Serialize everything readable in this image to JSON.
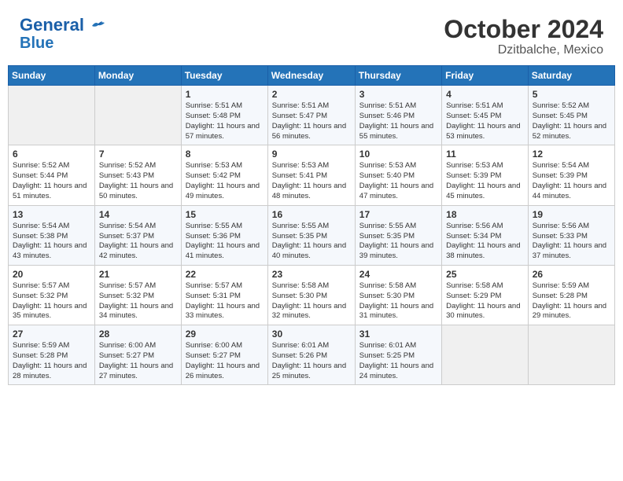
{
  "header": {
    "logo_line1": "General",
    "logo_line2": "Blue",
    "month": "October 2024",
    "location": "Dzitbalche, Mexico"
  },
  "weekdays": [
    "Sunday",
    "Monday",
    "Tuesday",
    "Wednesday",
    "Thursday",
    "Friday",
    "Saturday"
  ],
  "weeks": [
    [
      {
        "day": "",
        "sunrise": "",
        "sunset": "",
        "daylight": ""
      },
      {
        "day": "",
        "sunrise": "",
        "sunset": "",
        "daylight": ""
      },
      {
        "day": "1",
        "sunrise": "Sunrise: 5:51 AM",
        "sunset": "Sunset: 5:48 PM",
        "daylight": "Daylight: 11 hours and 57 minutes."
      },
      {
        "day": "2",
        "sunrise": "Sunrise: 5:51 AM",
        "sunset": "Sunset: 5:47 PM",
        "daylight": "Daylight: 11 hours and 56 minutes."
      },
      {
        "day": "3",
        "sunrise": "Sunrise: 5:51 AM",
        "sunset": "Sunset: 5:46 PM",
        "daylight": "Daylight: 11 hours and 55 minutes."
      },
      {
        "day": "4",
        "sunrise": "Sunrise: 5:51 AM",
        "sunset": "Sunset: 5:45 PM",
        "daylight": "Daylight: 11 hours and 53 minutes."
      },
      {
        "day": "5",
        "sunrise": "Sunrise: 5:52 AM",
        "sunset": "Sunset: 5:45 PM",
        "daylight": "Daylight: 11 hours and 52 minutes."
      }
    ],
    [
      {
        "day": "6",
        "sunrise": "Sunrise: 5:52 AM",
        "sunset": "Sunset: 5:44 PM",
        "daylight": "Daylight: 11 hours and 51 minutes."
      },
      {
        "day": "7",
        "sunrise": "Sunrise: 5:52 AM",
        "sunset": "Sunset: 5:43 PM",
        "daylight": "Daylight: 11 hours and 50 minutes."
      },
      {
        "day": "8",
        "sunrise": "Sunrise: 5:53 AM",
        "sunset": "Sunset: 5:42 PM",
        "daylight": "Daylight: 11 hours and 49 minutes."
      },
      {
        "day": "9",
        "sunrise": "Sunrise: 5:53 AM",
        "sunset": "Sunset: 5:41 PM",
        "daylight": "Daylight: 11 hours and 48 minutes."
      },
      {
        "day": "10",
        "sunrise": "Sunrise: 5:53 AM",
        "sunset": "Sunset: 5:40 PM",
        "daylight": "Daylight: 11 hours and 47 minutes."
      },
      {
        "day": "11",
        "sunrise": "Sunrise: 5:53 AM",
        "sunset": "Sunset: 5:39 PM",
        "daylight": "Daylight: 11 hours and 45 minutes."
      },
      {
        "day": "12",
        "sunrise": "Sunrise: 5:54 AM",
        "sunset": "Sunset: 5:39 PM",
        "daylight": "Daylight: 11 hours and 44 minutes."
      }
    ],
    [
      {
        "day": "13",
        "sunrise": "Sunrise: 5:54 AM",
        "sunset": "Sunset: 5:38 PM",
        "daylight": "Daylight: 11 hours and 43 minutes."
      },
      {
        "day": "14",
        "sunrise": "Sunrise: 5:54 AM",
        "sunset": "Sunset: 5:37 PM",
        "daylight": "Daylight: 11 hours and 42 minutes."
      },
      {
        "day": "15",
        "sunrise": "Sunrise: 5:55 AM",
        "sunset": "Sunset: 5:36 PM",
        "daylight": "Daylight: 11 hours and 41 minutes."
      },
      {
        "day": "16",
        "sunrise": "Sunrise: 5:55 AM",
        "sunset": "Sunset: 5:35 PM",
        "daylight": "Daylight: 11 hours and 40 minutes."
      },
      {
        "day": "17",
        "sunrise": "Sunrise: 5:55 AM",
        "sunset": "Sunset: 5:35 PM",
        "daylight": "Daylight: 11 hours and 39 minutes."
      },
      {
        "day": "18",
        "sunrise": "Sunrise: 5:56 AM",
        "sunset": "Sunset: 5:34 PM",
        "daylight": "Daylight: 11 hours and 38 minutes."
      },
      {
        "day": "19",
        "sunrise": "Sunrise: 5:56 AM",
        "sunset": "Sunset: 5:33 PM",
        "daylight": "Daylight: 11 hours and 37 minutes."
      }
    ],
    [
      {
        "day": "20",
        "sunrise": "Sunrise: 5:57 AM",
        "sunset": "Sunset: 5:32 PM",
        "daylight": "Daylight: 11 hours and 35 minutes."
      },
      {
        "day": "21",
        "sunrise": "Sunrise: 5:57 AM",
        "sunset": "Sunset: 5:32 PM",
        "daylight": "Daylight: 11 hours and 34 minutes."
      },
      {
        "day": "22",
        "sunrise": "Sunrise: 5:57 AM",
        "sunset": "Sunset: 5:31 PM",
        "daylight": "Daylight: 11 hours and 33 minutes."
      },
      {
        "day": "23",
        "sunrise": "Sunrise: 5:58 AM",
        "sunset": "Sunset: 5:30 PM",
        "daylight": "Daylight: 11 hours and 32 minutes."
      },
      {
        "day": "24",
        "sunrise": "Sunrise: 5:58 AM",
        "sunset": "Sunset: 5:30 PM",
        "daylight": "Daylight: 11 hours and 31 minutes."
      },
      {
        "day": "25",
        "sunrise": "Sunrise: 5:58 AM",
        "sunset": "Sunset: 5:29 PM",
        "daylight": "Daylight: 11 hours and 30 minutes."
      },
      {
        "day": "26",
        "sunrise": "Sunrise: 5:59 AM",
        "sunset": "Sunset: 5:28 PM",
        "daylight": "Daylight: 11 hours and 29 minutes."
      }
    ],
    [
      {
        "day": "27",
        "sunrise": "Sunrise: 5:59 AM",
        "sunset": "Sunset: 5:28 PM",
        "daylight": "Daylight: 11 hours and 28 minutes."
      },
      {
        "day": "28",
        "sunrise": "Sunrise: 6:00 AM",
        "sunset": "Sunset: 5:27 PM",
        "daylight": "Daylight: 11 hours and 27 minutes."
      },
      {
        "day": "29",
        "sunrise": "Sunrise: 6:00 AM",
        "sunset": "Sunset: 5:27 PM",
        "daylight": "Daylight: 11 hours and 26 minutes."
      },
      {
        "day": "30",
        "sunrise": "Sunrise: 6:01 AM",
        "sunset": "Sunset: 5:26 PM",
        "daylight": "Daylight: 11 hours and 25 minutes."
      },
      {
        "day": "31",
        "sunrise": "Sunrise: 6:01 AM",
        "sunset": "Sunset: 5:25 PM",
        "daylight": "Daylight: 11 hours and 24 minutes."
      },
      {
        "day": "",
        "sunrise": "",
        "sunset": "",
        "daylight": ""
      },
      {
        "day": "",
        "sunrise": "",
        "sunset": "",
        "daylight": ""
      }
    ]
  ]
}
